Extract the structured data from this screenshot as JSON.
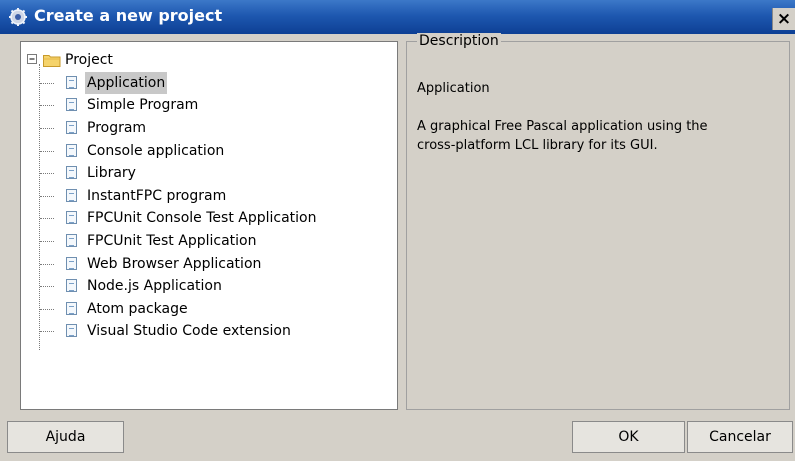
{
  "window": {
    "title": "Create a new project",
    "close_label": "×"
  },
  "tree": {
    "root": {
      "label": "Project",
      "expander": "⊟"
    },
    "items": [
      {
        "label": "Application",
        "selected": true
      },
      {
        "label": "Simple Program"
      },
      {
        "label": "Program"
      },
      {
        "label": "Console application"
      },
      {
        "label": "Library"
      },
      {
        "label": "InstantFPC program"
      },
      {
        "label": "FPCUnit Console Test Application"
      },
      {
        "label": "FPCUnit Test Application"
      },
      {
        "label": "Web Browser Application"
      },
      {
        "label": "Node.js Application"
      },
      {
        "label": "Atom package"
      },
      {
        "label": "Visual Studio Code extension"
      }
    ]
  },
  "description": {
    "legend": "Description",
    "title": "Application",
    "text_line1": "A graphical Free Pascal application using the",
    "text_line2": "cross-platform LCL library for its GUI."
  },
  "buttons": {
    "help": "Ajuda",
    "ok": "OK",
    "cancel": "Cancelar"
  },
  "icons": {
    "app": "gear-app-icon",
    "folder": "folder-icon",
    "item": "document-icon"
  }
}
